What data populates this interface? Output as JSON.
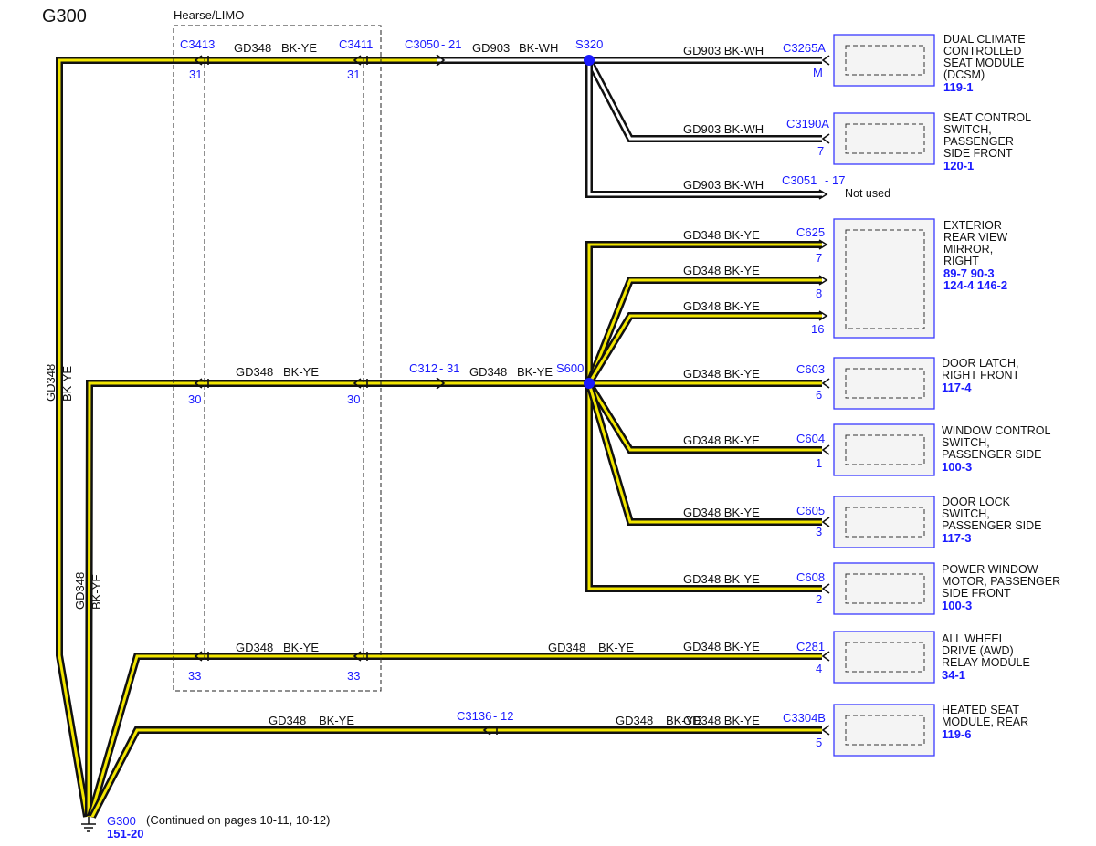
{
  "diagram": {
    "title": "G300",
    "box_label": "Hearse/LIMO",
    "ground": {
      "id": "G300",
      "ref": "151-20",
      "note": "(Continued on pages 10-11, 10-12)"
    },
    "splices": [
      "S320",
      "S600"
    ],
    "vertical_labels": [
      {
        "circuit": "GD348",
        "color": "BK-YE"
      },
      {
        "circuit": "GD348",
        "color": "BK-YE"
      }
    ],
    "top_branch": {
      "connectors": [
        {
          "id": "C3413",
          "pin": "31"
        },
        {
          "id": "C3411",
          "pin": "31"
        },
        {
          "id": "C3050",
          "pin": "21"
        }
      ],
      "segments": [
        {
          "circuit": "GD348",
          "color": "BK-YE"
        },
        {
          "circuit": "GD903",
          "color": "BK-WH"
        }
      ]
    },
    "mid_branch": {
      "connectors": [
        {
          "id": "",
          "pin": "30"
        },
        {
          "id": "",
          "pin": "30"
        },
        {
          "id": "C312",
          "pin": "31"
        }
      ],
      "segments": [
        {
          "circuit": "GD348",
          "color": "BK-YE"
        },
        {
          "circuit": "GD348",
          "color": "BK-YE"
        }
      ]
    },
    "low_branch": {
      "connectors": [
        {
          "id": "",
          "pin": "33"
        },
        {
          "id": "",
          "pin": "33"
        }
      ],
      "segments": [
        {
          "circuit": "GD348",
          "color": "BK-YE"
        },
        {
          "circuit": "GD348",
          "color": "BK-YE"
        }
      ]
    },
    "bottom_branch": {
      "connectors": [
        {
          "id": "C3136",
          "pin": "12"
        }
      ],
      "segments": [
        {
          "circuit": "GD348",
          "color": "BK-YE"
        },
        {
          "circuit": "GD348",
          "color": "BK-YE"
        }
      ]
    },
    "components": [
      {
        "wire": "GD903  BK-WH",
        "connector": "C3265A",
        "pin": "M",
        "name": [
          "DUAL CLIMATE",
          "CONTROLLED",
          "SEAT MODULE",
          "(DCSM)"
        ],
        "refs": [
          "119-1"
        ]
      },
      {
        "wire": "GD903  BK-WH",
        "connector": "C3190A",
        "pin": "7",
        "name": [
          "SEAT CONTROL",
          "SWITCH,",
          "PASSENGER",
          "SIDE FRONT"
        ],
        "refs": [
          "120-1"
        ]
      },
      {
        "wire": "GD903  BK-WH",
        "connector": "C3051",
        "pin": "17",
        "name": [
          "Not used"
        ],
        "refs": []
      },
      {
        "wire": "GD348  BK-YE",
        "connector": "C625",
        "pin": "7",
        "name": [
          "EXTERIOR",
          "REAR VIEW",
          "MIRROR,",
          "RIGHT"
        ],
        "refs": [
          "89-7   90-3",
          "124-4  146-2"
        ]
      },
      {
        "wire": "GD348  BK-YE",
        "connector": "",
        "pin": "8",
        "name": [],
        "refs": []
      },
      {
        "wire": "GD348  BK-YE",
        "connector": "",
        "pin": "16",
        "name": [],
        "refs": []
      },
      {
        "wire": "GD348  BK-YE",
        "connector": "C603",
        "pin": "6",
        "name": [
          "DOOR LATCH,",
          "RIGHT FRONT"
        ],
        "refs": [
          "117-4"
        ]
      },
      {
        "wire": "GD348  BK-YE",
        "connector": "C604",
        "pin": "1",
        "name": [
          "WINDOW CONTROL",
          "SWITCH,",
          "PASSENGER SIDE"
        ],
        "refs": [
          "100-3"
        ]
      },
      {
        "wire": "GD348  BK-YE",
        "connector": "C605",
        "pin": "3",
        "name": [
          "DOOR LOCK",
          "SWITCH,",
          "PASSENGER SIDE"
        ],
        "refs": [
          "117-3"
        ]
      },
      {
        "wire": "GD348  BK-YE",
        "connector": "C608",
        "pin": "2",
        "name": [
          "POWER WINDOW",
          "MOTOR, PASSENGER",
          "SIDE FRONT"
        ],
        "refs": [
          "100-3"
        ]
      },
      {
        "wire": "GD348  BK-YE",
        "connector": "C281",
        "pin": "4",
        "name": [
          "ALL WHEEL",
          "DRIVE (AWD)",
          "RELAY MODULE"
        ],
        "refs": [
          "34-1"
        ]
      },
      {
        "wire": "GD348  BK-YE",
        "connector": "C3304B",
        "pin": "5",
        "name": [
          "HEATED SEAT",
          "MODULE, REAR"
        ],
        "refs": [
          "119-6"
        ]
      }
    ]
  }
}
